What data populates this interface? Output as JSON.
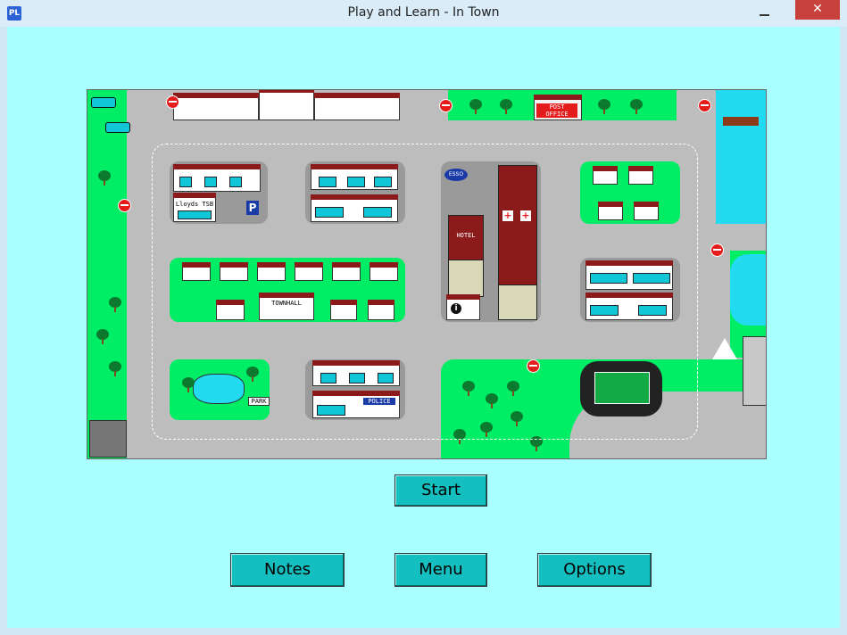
{
  "window": {
    "title": "Play and Learn - In Town",
    "app_icon": "PL"
  },
  "map": {
    "labels": {
      "lloyds": "Lloyds TSB",
      "parking": "P",
      "post_office": "POST OFFICE",
      "hotel": "HOTEL",
      "info": "i",
      "townhall": "TOWNHALL",
      "police": "POLICE",
      "esso": "ESSO",
      "park": "PARK"
    }
  },
  "buttons": {
    "start": "Start",
    "notes": "Notes",
    "menu": "Menu",
    "options": "Options"
  },
  "colors": {
    "background": "#aaffff",
    "button": "#15bfbf",
    "road": "#bdbdbd",
    "grass": "#00ee66"
  }
}
